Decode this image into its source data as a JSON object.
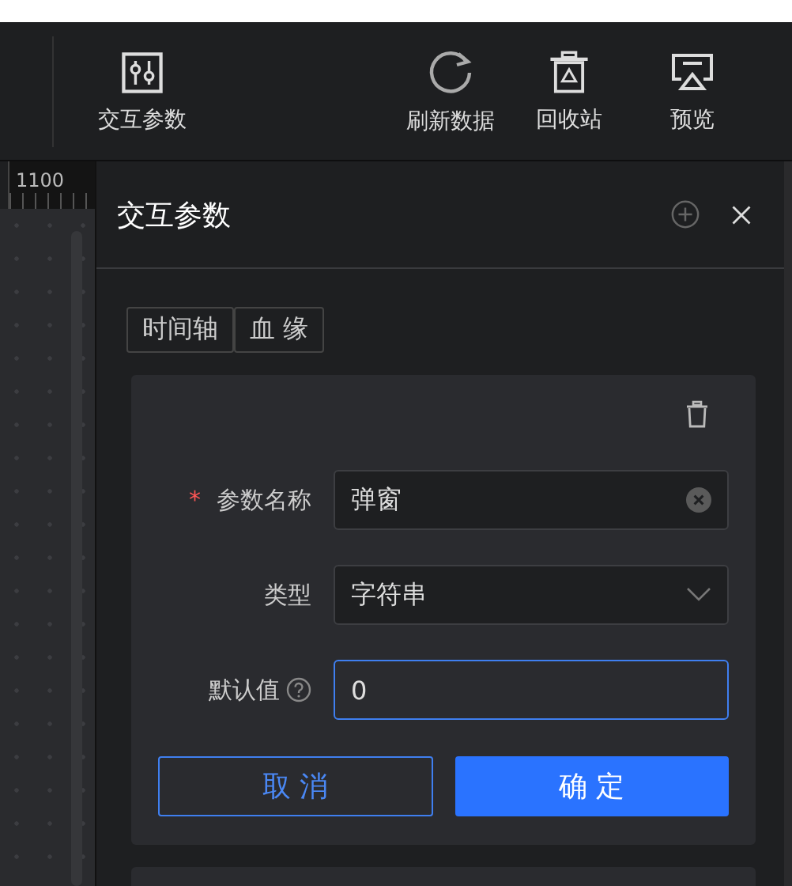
{
  "toolbar": {
    "items": [
      {
        "kind": "params",
        "label": "交互参数"
      },
      {
        "kind": "refresh",
        "label": "刷新数据"
      },
      {
        "kind": "recycle",
        "label": "回收站"
      },
      {
        "kind": "preview",
        "label": "预览"
      }
    ]
  },
  "ruler": {
    "label": "1100"
  },
  "panel": {
    "title": "交互参数",
    "tabs": [
      {
        "label": "时间轴"
      },
      {
        "label": "血 缘"
      }
    ],
    "fields": [
      {
        "kind": "text",
        "label": "参数名称",
        "required_mark": "*",
        "help": false,
        "value": "弹窗",
        "clearable": true,
        "focused": false
      },
      {
        "kind": "select",
        "label": "类型",
        "help": false,
        "value": "字符串",
        "clearable": false,
        "focused": false
      },
      {
        "kind": "text",
        "label": "默认值",
        "help": true,
        "value": "0",
        "clearable": false,
        "focused": true
      }
    ],
    "buttons": [
      {
        "kind": "secondary",
        "label": "取 消"
      },
      {
        "kind": "primary",
        "label": "确 定"
      }
    ]
  }
}
